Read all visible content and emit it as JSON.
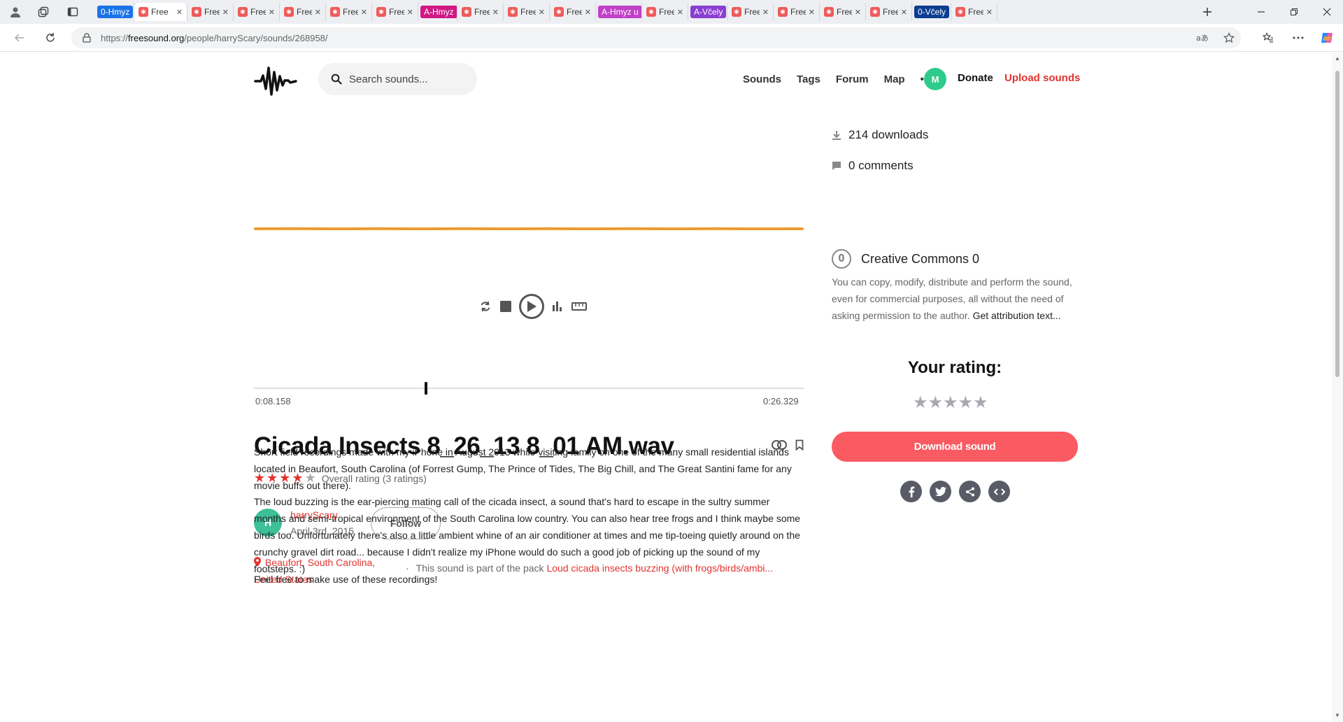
{
  "browser": {
    "tabs": [
      {
        "type": "group",
        "label": "0-Hmyz",
        "color": "#1a73e8"
      },
      {
        "type": "tab",
        "title": "Free",
        "active": true
      },
      {
        "type": "tab",
        "title": "Free"
      },
      {
        "type": "tab",
        "title": "Free"
      },
      {
        "type": "tab",
        "title": "Free"
      },
      {
        "type": "tab",
        "title": "Free"
      },
      {
        "type": "tab",
        "title": "Free"
      },
      {
        "type": "group",
        "label": "A-Hmyz",
        "color": "#d01884"
      },
      {
        "type": "tab",
        "title": "Free"
      },
      {
        "type": "tab",
        "title": "Free"
      },
      {
        "type": "tab",
        "title": "Free"
      },
      {
        "type": "group",
        "label": "A-Hmyz u",
        "color": "#c040c8"
      },
      {
        "type": "tab",
        "title": "Free"
      },
      {
        "type": "group",
        "label": "A-Včely",
        "color": "#8a3fd1"
      },
      {
        "type": "tab",
        "title": "Free"
      },
      {
        "type": "tab",
        "title": "Free"
      },
      {
        "type": "tab",
        "title": "Free"
      },
      {
        "type": "tab",
        "title": "Free"
      },
      {
        "type": "group",
        "label": "0-Včely",
        "color": "#0b3d91"
      },
      {
        "type": "tab",
        "title": "Free"
      }
    ],
    "url_prefix": "https://",
    "url_domain": "freesound.org",
    "url_path": "/people/harryScary/sounds/268958/"
  },
  "header": {
    "search_placeholder": "Search sounds...",
    "nav": [
      "Sounds",
      "Tags",
      "Forum",
      "Map"
    ],
    "more": "•••",
    "user_initial": "M",
    "donate": "Donate",
    "upload": "Upload sounds"
  },
  "player": {
    "current_time": "0:08.158",
    "total_time": "0:26.329",
    "position_fraction": 0.31,
    "wave_color": "#f5a43c"
  },
  "sound": {
    "title": "Cicada Insects 8_26_13 8_01 AM.wav",
    "rating_value": 4,
    "rating_text": "Overall rating (3 ratings)",
    "user_initial": "H",
    "username": "harryScary",
    "date": "April 3rd, 2015",
    "follow_label": "Follow",
    "location": "Beaufort, South Carolina, United States",
    "pack_prefix": "This sound is part of the pack",
    "pack_name": "Loud cicada insects buzzing (with frogs/birds/ambi...",
    "description": [
      "Short field recordings made with my iPhone in August 2013 while visiting family on one of the many small residential islands located in Beaufort, South Carolina (of Forrest Gump, The Prince of Tides, The Big Chill, and The Great Santini fame for any movie buffs out there).",
      "The loud buzzing is the ear-piercing mating call of the cicada insect, a sound that's hard to escape in the sultry summer months and semi-tropical environment of the South Carolina low country. You can also hear tree frogs and I think maybe some birds too. Unfortunately there's also a little ambient whine of an air conditioner at times and me tip-toeing quietly around on the crunchy gravel dirt road... because I didn't realize my iPhone would do such a good job of picking up the sound of my footsteps. :)",
      "Feel free to make use of these recordings!"
    ]
  },
  "sidebar": {
    "downloads": "214 downloads",
    "comments": "0 comments",
    "license_badge": "0",
    "license": "Creative Commons 0",
    "license_desc": "You can copy, modify, distribute and perform the sound, even for commercial purposes, all without the need of asking permission to the author.",
    "attribution_link": "Get attribution text...",
    "your_rating": "Your rating:",
    "download_label": "Download sound",
    "accent": "#fa5a62"
  }
}
